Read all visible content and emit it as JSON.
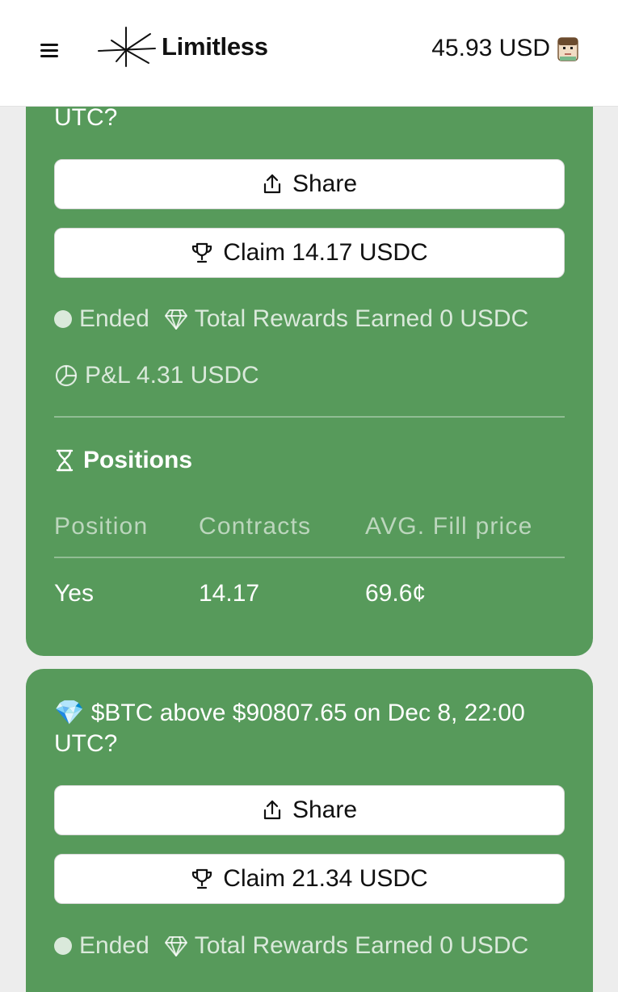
{
  "header": {
    "brand": "Limitless",
    "balance": "45.93 USD"
  },
  "card1": {
    "title_fragment": "UTC?",
    "share_label": "Share",
    "claim_label": "Claim 14.17 USDC",
    "status": "Ended",
    "rewards": "Total Rewards Earned 0 USDC",
    "pnl": "P&L 4.31 USDC",
    "positions_heading": "Positions",
    "table": {
      "headers": [
        "Position",
        "Contracts",
        "AVG. Fill price"
      ],
      "rows": [
        [
          "Yes",
          "14.17",
          "69.6¢"
        ]
      ]
    }
  },
  "card2": {
    "title_emoji": "💎",
    "title": "$BTC above $90807.65 on Dec 8, 22:00 UTC?",
    "share_label": "Share",
    "claim_label": "Claim 21.34 USDC",
    "status": "Ended",
    "rewards": "Total Rewards Earned 0 USDC"
  },
  "colors": {
    "card_green": "#579a5b",
    "button_bg": "#ffffff",
    "header_bg": "#ffffff"
  },
  "icons": [
    "menu-icon",
    "logo-icon",
    "avatar-icon",
    "share-icon",
    "trophy-icon",
    "status-dot-icon",
    "diamond-icon",
    "pie-chart-icon",
    "hourglass-icon"
  ]
}
